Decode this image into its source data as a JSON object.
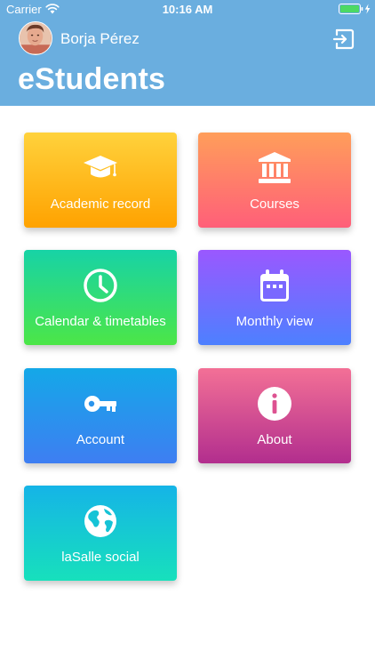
{
  "status_bar": {
    "carrier": "Carrier",
    "time": "10:16 AM",
    "wifi_icon": "wifi-icon",
    "battery_icon": "battery-icon",
    "charging_icon": "bolt-icon"
  },
  "header": {
    "user_name": "Borja Pérez",
    "app_title": "eStudents",
    "logout_icon": "logout-icon",
    "background_color": "#6aaedf"
  },
  "tiles": [
    {
      "label": "Academic record",
      "icon": "graduation-cap-icon",
      "gradient": [
        "#ffd23c",
        "#ffa200"
      ]
    },
    {
      "label": "Courses",
      "icon": "bank-building-icon",
      "gradient": [
        "#ff9e5a",
        "#ff5f79"
      ]
    },
    {
      "label": "Calendar & timetables",
      "icon": "clock-icon",
      "gradient": [
        "#17d3a6",
        "#4ce647"
      ]
    },
    {
      "label": "Monthly view",
      "icon": "calendar-icon",
      "gradient": [
        "#9a58ff",
        "#4d80ff"
      ]
    },
    {
      "label": "Account",
      "icon": "key-icon",
      "gradient": [
        "#14a8e8",
        "#3e7ef2"
      ]
    },
    {
      "label": "About",
      "icon": "info-icon",
      "gradient": [
        "#f37096",
        "#b22e8e"
      ]
    },
    {
      "label": "laSalle social",
      "icon": "globe-icon",
      "gradient": [
        "#15b4e7",
        "#17e0bc"
      ]
    }
  ]
}
